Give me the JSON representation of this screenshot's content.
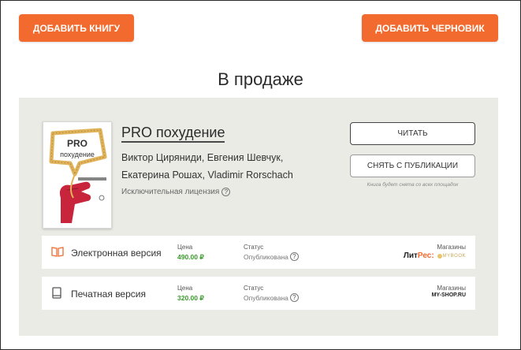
{
  "toolbar": {
    "add_book_label": "ДОБАВИТЬ КНИГУ",
    "add_draft_label": "ДОБАВИТЬ ЧЕРНОВИК"
  },
  "section": {
    "title": "В продаже"
  },
  "book": {
    "title": "PRO похудение",
    "authors": "Виктор Циряниди, Евгения Шевчук, Екатерина Рошах, Vladimir Rorschach",
    "license": "Исключительная лицензия",
    "cover": {
      "title_line1": "PRO",
      "title_line2": "похудение"
    },
    "read_label": "ЧИТАТЬ",
    "unpublish_label": "СНЯТЬ С ПУБЛИКАЦИИ",
    "unpublish_note": "Книга будет снята со всех площадок"
  },
  "versions": [
    {
      "name": "Электронная версия",
      "price_label": "Цена",
      "price": "490.00 ₽",
      "status_label": "Статус",
      "status": "Опубликована",
      "stores_label": "Магазины",
      "stores": [
        "ЛитРес:",
        "MYBOOK"
      ]
    },
    {
      "name": "Печатная версия",
      "price_label": "Цена",
      "price": "320.00 ₽",
      "status_label": "Статус",
      "status": "Опубликована",
      "stores_label": "Магазины",
      "stores": [
        "MY-SHOP.RU"
      ]
    }
  ],
  "colors": {
    "accent": "#f26a2e",
    "panel": "#ebebe6",
    "price": "#3a9b2c"
  }
}
